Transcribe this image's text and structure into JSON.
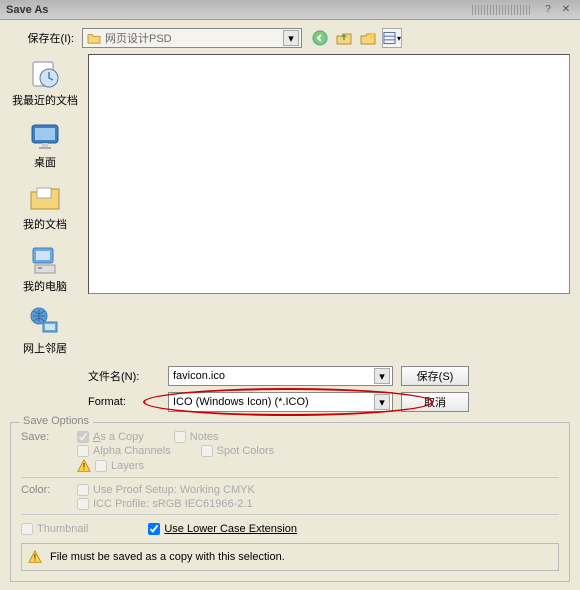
{
  "titlebar": {
    "title": "Save As"
  },
  "savein": {
    "label": "保存在(I):",
    "value": "网页设计PSD"
  },
  "toolbar_icons": [
    "back-icon",
    "up-icon",
    "new-folder-icon",
    "view-icon"
  ],
  "sidebar": {
    "items": [
      {
        "label": "我最近的文档",
        "icon": "recent"
      },
      {
        "label": "桌面",
        "icon": "desktop"
      },
      {
        "label": "我的文档",
        "icon": "mydocs"
      },
      {
        "label": "我的电脑",
        "icon": "mycomputer"
      },
      {
        "label": "网上邻居",
        "icon": "network"
      }
    ]
  },
  "filename": {
    "label": "文件名(N):",
    "value": "favicon.ico"
  },
  "format": {
    "label": "Format:",
    "value": "ICO (Windows Icon) (*.ICO)"
  },
  "buttons": {
    "save": "保存(S)",
    "cancel": "取消"
  },
  "options": {
    "title": "Save Options",
    "save_label": "Save:",
    "as_copy": "As a Copy",
    "notes": "Notes",
    "alpha": "Alpha Channels",
    "spot": "Spot Colors",
    "layers": "Layers",
    "color_label": "Color:",
    "proof": "Use Proof Setup:   Working CMYK",
    "icc": "ICC Profile:   sRGB IEC61966-2.1",
    "thumbnail": "Thumbnail",
    "lowercase": "Use Lower Case Extension"
  },
  "notice": "File must be saved as a copy with this selection."
}
